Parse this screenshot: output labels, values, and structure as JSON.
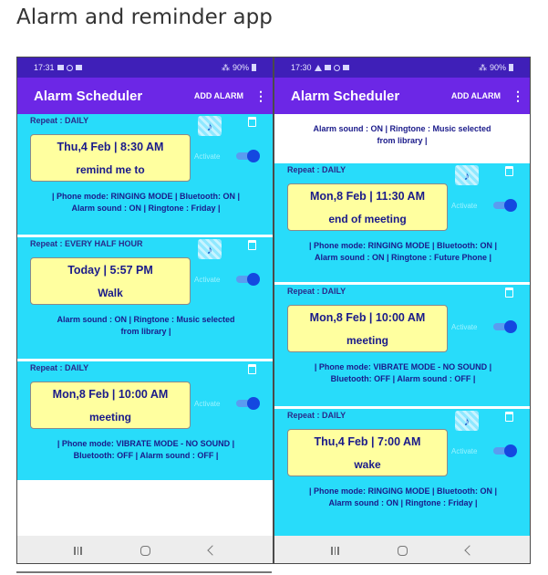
{
  "page_heading": "Alarm and reminder app",
  "phones": [
    {
      "status": {
        "time": "17:31",
        "battery": "90%"
      },
      "app_bar": {
        "title": "Alarm Scheduler",
        "add_alarm": "ADD ALARM",
        "menu": "⋮"
      },
      "cards": [
        {
          "repeat": "Repeat : DAILY",
          "time": "Thu,4 Feb | 8:30 AM",
          "label": "remind me to",
          "activate": "Activate",
          "active": true,
          "details_line1": "| Phone mode: RINGING MODE | Bluetooth: ON |",
          "details_line2": "Alarm sound : ON | Ringtone : Friday |"
        },
        {
          "repeat": "Repeat : EVERY HALF HOUR",
          "time": "Today | 5:57 PM",
          "label": "Walk",
          "activate": "Activate",
          "active": true,
          "details_line1": "Alarm sound : ON | Ringtone : Music selected",
          "details_line2": "from library |"
        },
        {
          "repeat": "Repeat : DAILY",
          "time": "Mon,8 Feb | 10:00 AM",
          "label": "meeting",
          "activate": "Activate",
          "active": true,
          "details_line1": "| Phone mode: VIBRATE MODE - NO SOUND |",
          "details_line2": "Bluetooth: OFF | Alarm sound : OFF |"
        }
      ]
    },
    {
      "status": {
        "time": "17:30",
        "battery": "90%"
      },
      "app_bar": {
        "title": "Alarm Scheduler",
        "add_alarm": "ADD ALARM",
        "menu": "⋮"
      },
      "top_details": {
        "line1": "Alarm sound : ON | Ringtone : Music selected",
        "line2": "from library |"
      },
      "cards": [
        {
          "repeat": "Repeat : DAILY",
          "time": "Mon,8 Feb | 11:30 AM",
          "label": "end of meeting",
          "activate": "Activate",
          "active": true,
          "details_line1": "| Phone mode: RINGING MODE | Bluetooth: ON |",
          "details_line2": "Alarm sound : ON | Ringtone : Future Phone |"
        },
        {
          "repeat": "Repeat : DAILY",
          "time": "Mon,8 Feb | 10:00 AM",
          "label": "meeting",
          "activate": "Activate",
          "active": true,
          "details_line1": "| Phone mode: VIBRATE MODE - NO SOUND |",
          "details_line2": "Bluetooth: OFF | Alarm sound : OFF |"
        },
        {
          "repeat": "Repeat : DAILY",
          "time": "Thu,4 Feb | 7:00 AM",
          "label": "wake",
          "activate": "Activate",
          "active": true,
          "details_line1": "| Phone mode: RINGING MODE | Bluetooth: ON |",
          "details_line2": "Alarm sound : ON | Ringtone : Friday |"
        }
      ]
    }
  ],
  "colors": {
    "app_bar": "#6c27e6",
    "status_bar": "#3f1fb8",
    "card": "#28dcfa",
    "time_box": "#ffff9f",
    "toggle_on": "#1448e0"
  }
}
